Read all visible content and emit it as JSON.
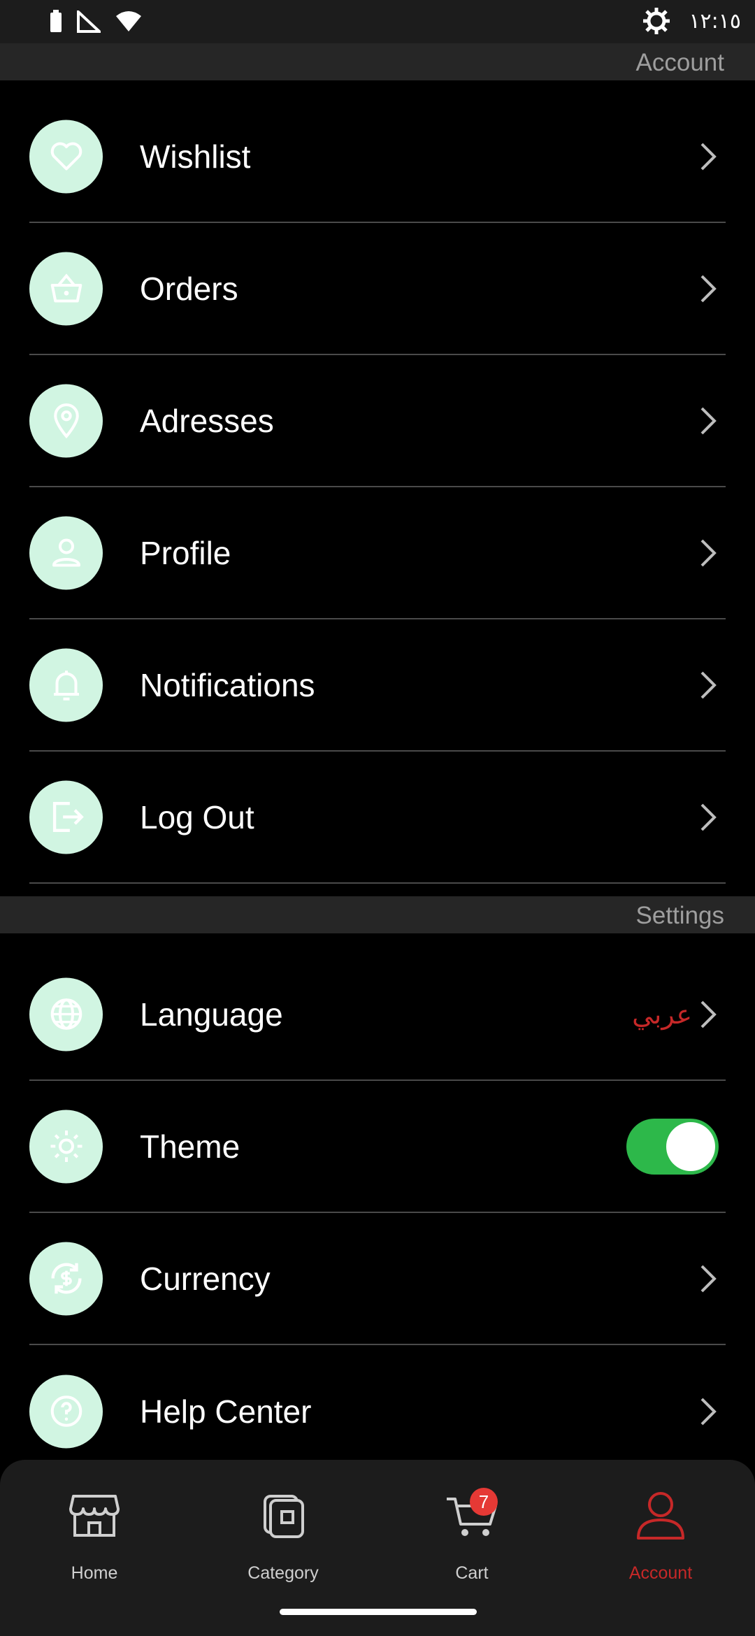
{
  "status_bar": {
    "time": "١٢:١٥"
  },
  "sections": {
    "account_title": "Account",
    "settings_title": "Settings"
  },
  "account_items": [
    {
      "label": "Wishlist",
      "icon": "heart-icon"
    },
    {
      "label": "Orders",
      "icon": "basket-icon"
    },
    {
      "label": "Adresses",
      "icon": "location-pin-icon"
    },
    {
      "label": "Profile",
      "icon": "user-icon"
    },
    {
      "label": "Notifications",
      "icon": "bell-icon"
    },
    {
      "label": "Log Out",
      "icon": "logout-icon"
    }
  ],
  "settings_items": [
    {
      "label": "Language",
      "icon": "globe-icon",
      "value": "عربي"
    },
    {
      "label": "Theme",
      "icon": "sun-icon",
      "toggle_on": true
    },
    {
      "label": "Currency",
      "icon": "currency-exchange-icon"
    },
    {
      "label": "Help Center",
      "icon": "help-icon"
    }
  ],
  "bottom_nav": {
    "items": [
      {
        "label": "Home",
        "icon": "store-icon"
      },
      {
        "label": "Category",
        "icon": "category-icon"
      },
      {
        "label": "Cart",
        "icon": "cart-icon",
        "badge": "7"
      },
      {
        "label": "Account",
        "icon": "user-icon",
        "active": true
      }
    ]
  },
  "colors": {
    "icon_circle": "#d1f5e2",
    "accent_red": "#c62828",
    "toggle_green": "#2db84a",
    "badge_red": "#e53935"
  }
}
